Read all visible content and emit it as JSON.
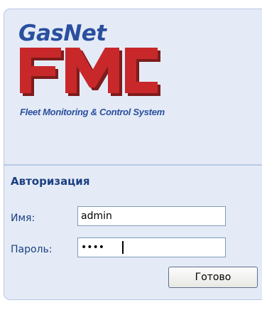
{
  "branding": {
    "gasnet": "GasNet",
    "fmc": "FMC",
    "subtitle": "Fleet Monitoring & Control System",
    "colors": {
      "blue": "#2a4f9e",
      "red": "#c8282a",
      "shadow": "#7d1c1c"
    }
  },
  "auth": {
    "title": "Авторизация",
    "username_label": "Имя:",
    "username_value": "admin",
    "password_label": "Пароль:",
    "password_masked": "••••",
    "submit_label": "Готово"
  },
  "colors": {
    "panel": "#e4ebf7",
    "text": "#1d3f80"
  }
}
